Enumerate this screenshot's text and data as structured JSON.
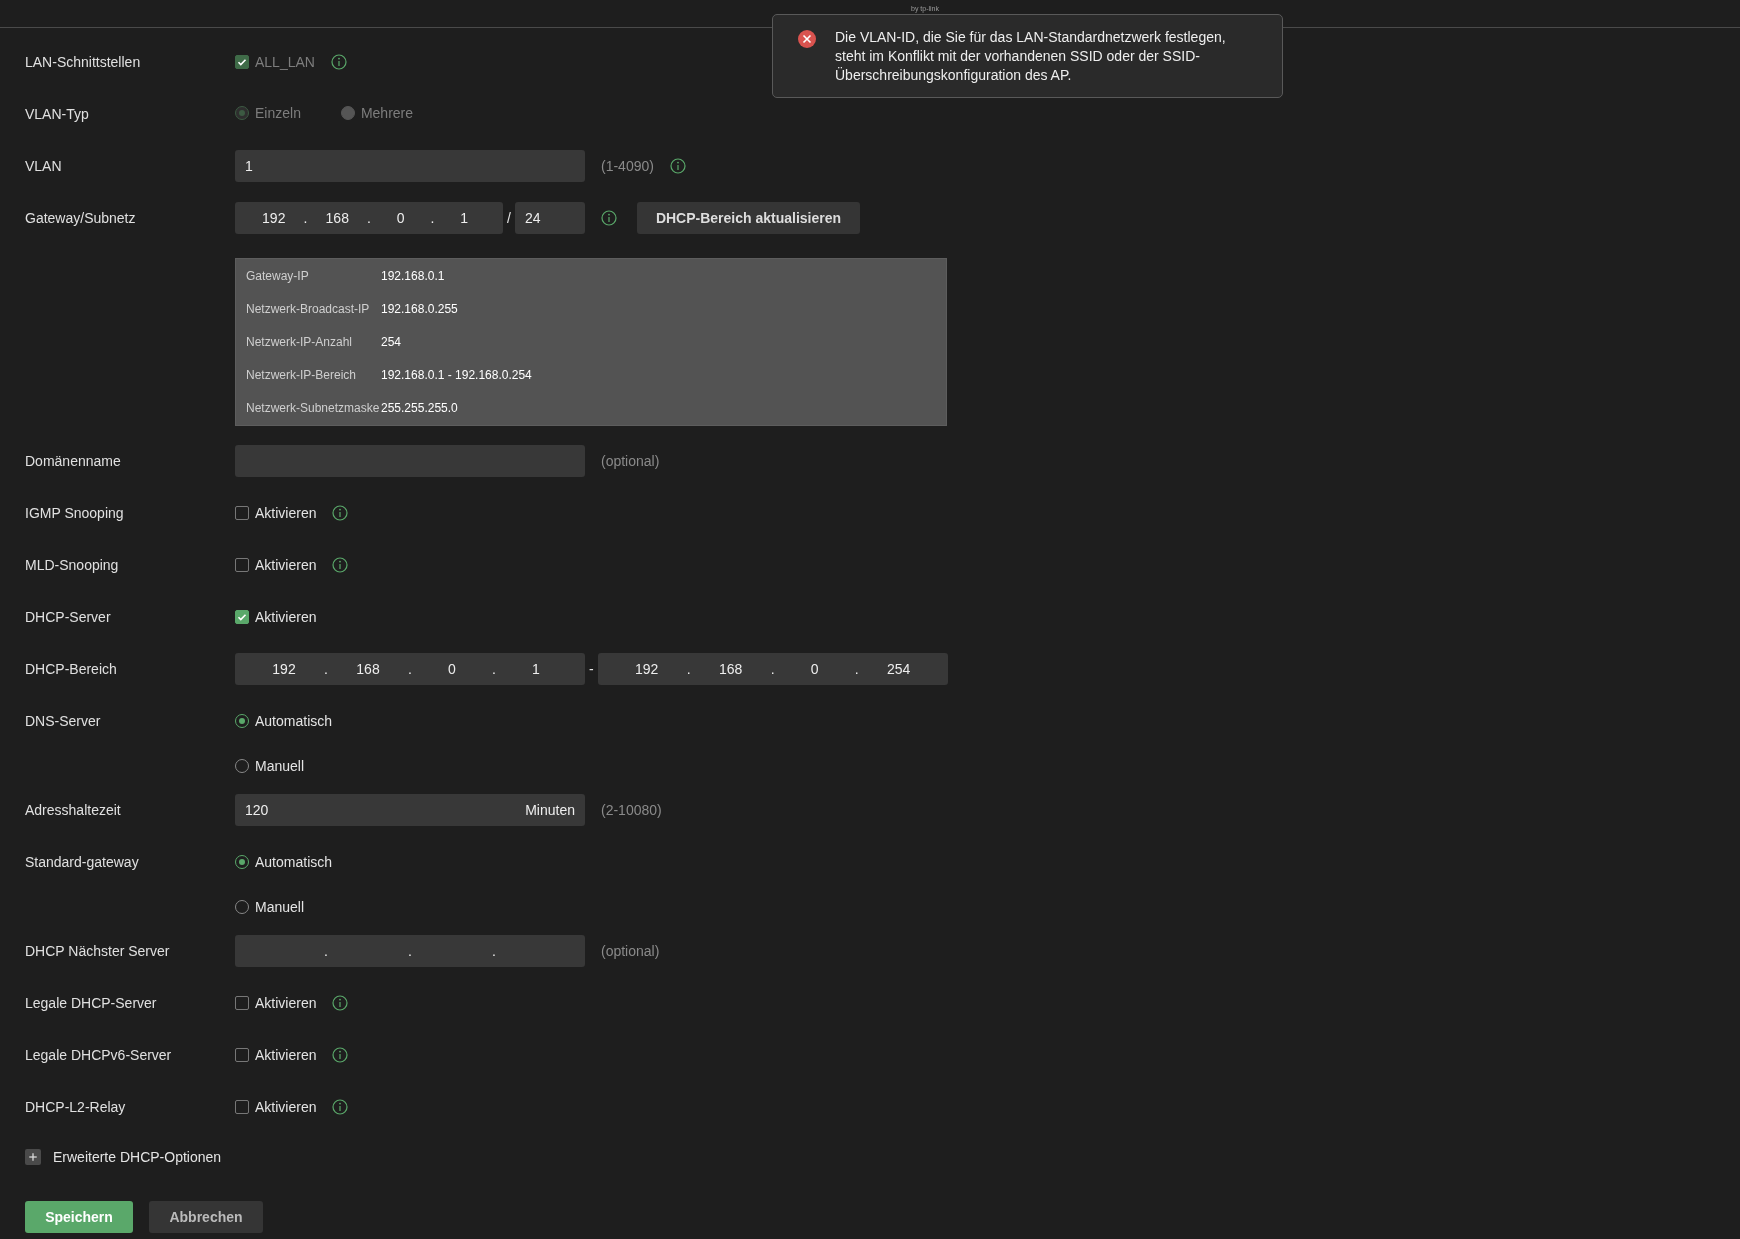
{
  "header": {
    "brand_sub": "by tp-link"
  },
  "toast": {
    "kind": "error",
    "message": "Die VLAN-ID, die Sie für das LAN-Standardnetzwerk festlegen, steht im Konflikt mit der vorhandenen SSID oder der SSID-Überschreibungskonfiguration des AP."
  },
  "rows": [
    {
      "kind": "checkbox",
      "label": "LAN-Schnittstellen",
      "options": [
        {
          "label": "ALL_LAN",
          "checked": true,
          "disabled": true
        }
      ],
      "info": true
    },
    {
      "kind": "radio_inline",
      "label": "VLAN-Typ",
      "options": [
        {
          "label": "Einzeln",
          "selected": true,
          "disabled": true
        },
        {
          "label": "Mehrere",
          "selected": false,
          "disabled": true
        }
      ]
    },
    {
      "kind": "text",
      "label": "VLAN",
      "value": "1",
      "hint": "(1-4090)",
      "info": true
    },
    {
      "kind": "subnet",
      "label": "Gateway/Subnetz",
      "octets": [
        "192",
        "168",
        "0",
        "1"
      ],
      "separator": ".",
      "slash": "/",
      "prefix": "24",
      "info": true,
      "button": "DHCP-Bereich aktualisieren",
      "details": [
        {
          "name": "Gateway-IP",
          "value": "192.168.0.1"
        },
        {
          "name": "Netzwerk-Broadcast-IP",
          "value": "192.168.0.255"
        },
        {
          "name": "Netzwerk-IP-Anzahl",
          "value": "254"
        },
        {
          "name": "Netzwerk-IP-Bereich",
          "value": "192.168.0.1 - 192.168.0.254"
        },
        {
          "name": "Netzwerk-Subnetzmaske",
          "value": "255.255.255.0"
        }
      ]
    },
    {
      "kind": "text",
      "label": "Domänenname",
      "hint": "(optional)"
    },
    {
      "kind": "checkbox",
      "label": "IGMP Snooping",
      "options": [
        {
          "label": "Aktivieren",
          "checked": false,
          "disabled": false
        }
      ],
      "info": true
    },
    {
      "kind": "checkbox",
      "label": "MLD-Snooping",
      "options": [
        {
          "label": "Aktivieren",
          "checked": false,
          "disabled": false
        }
      ],
      "info": true
    },
    {
      "kind": "checkbox",
      "label": "DHCP-Server",
      "options": [
        {
          "label": "Aktivieren",
          "checked": true,
          "disabled": false
        }
      ]
    },
    {
      "kind": "range",
      "label": "DHCP-Bereich",
      "separator": ".",
      "dash": "-",
      "start": [
        "192",
        "168",
        "0",
        "1"
      ],
      "end": [
        "192",
        "168",
        "0",
        "254"
      ]
    },
    {
      "kind": "radio_stacked",
      "label": "DNS-Server",
      "options": [
        {
          "label": "Automatisch",
          "selected": true,
          "disabled": false
        },
        {
          "label": "Manuell",
          "selected": false,
          "disabled": false
        }
      ]
    },
    {
      "kind": "text",
      "label": "Adresshaltezeit",
      "value": "120",
      "suffix": "Minuten",
      "hint": "(2-10080)"
    },
    {
      "kind": "radio_stacked",
      "label": "Standard-gateway",
      "options": [
        {
          "label": "Automatisch",
          "selected": true,
          "disabled": false
        },
        {
          "label": "Manuell",
          "selected": false,
          "disabled": false
        }
      ]
    },
    {
      "kind": "ip",
      "label": "DHCP Nächster Server",
      "separators": [
        ".",
        ".",
        "."
      ],
      "hint": "(optional)"
    },
    {
      "kind": "checkbox",
      "label": "Legale DHCP-Server",
      "options": [
        {
          "label": "Aktivieren",
          "checked": false,
          "disabled": false
        }
      ],
      "info": true
    },
    {
      "kind": "checkbox",
      "label": "Legale DHCPv6-Server",
      "options": [
        {
          "label": "Aktivieren",
          "checked": false,
          "disabled": false
        }
      ],
      "info": true
    },
    {
      "kind": "checkbox",
      "label": "DHCP-L2-Relay",
      "options": [
        {
          "label": "Aktivieren",
          "checked": false,
          "disabled": false
        }
      ],
      "info": true
    }
  ],
  "expander": {
    "label": "Erweiterte DHCP-Optionen",
    "expanded": false
  },
  "buttons": [
    {
      "label": "Speichern",
      "kind": "primary"
    },
    {
      "label": "Abbrechen",
      "kind": "secondary"
    }
  ]
}
